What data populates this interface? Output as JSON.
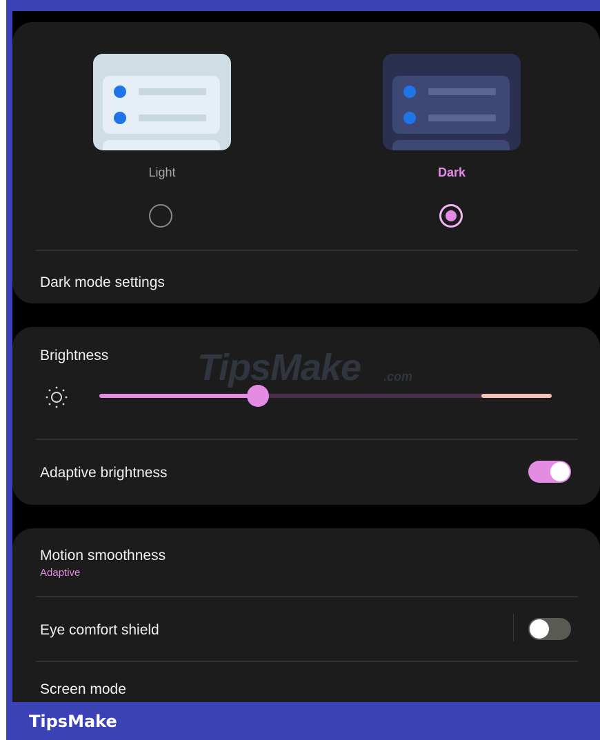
{
  "theme_options": {
    "light_label": "Light",
    "dark_label": "Dark",
    "selected": "Dark"
  },
  "dark_mode_settings": {
    "label": "Dark mode settings"
  },
  "brightness": {
    "label": "Brightness",
    "level": 0.35,
    "icon": "sun-icon"
  },
  "adaptive_brightness": {
    "label": "Adaptive brightness",
    "enabled": true
  },
  "motion_smoothness": {
    "label": "Motion smoothness",
    "value": "Adaptive"
  },
  "eye_comfort_shield": {
    "label": "Eye comfort shield",
    "enabled": false
  },
  "screen_mode": {
    "label": "Screen mode"
  },
  "watermark": {
    "text": "TipsMake",
    "suffix": ".com"
  },
  "footer": {
    "brand": "TipsMake"
  },
  "colors": {
    "accent": "#e48be4",
    "card_background": "#1c1c1c",
    "frame": "#3b42b5"
  }
}
